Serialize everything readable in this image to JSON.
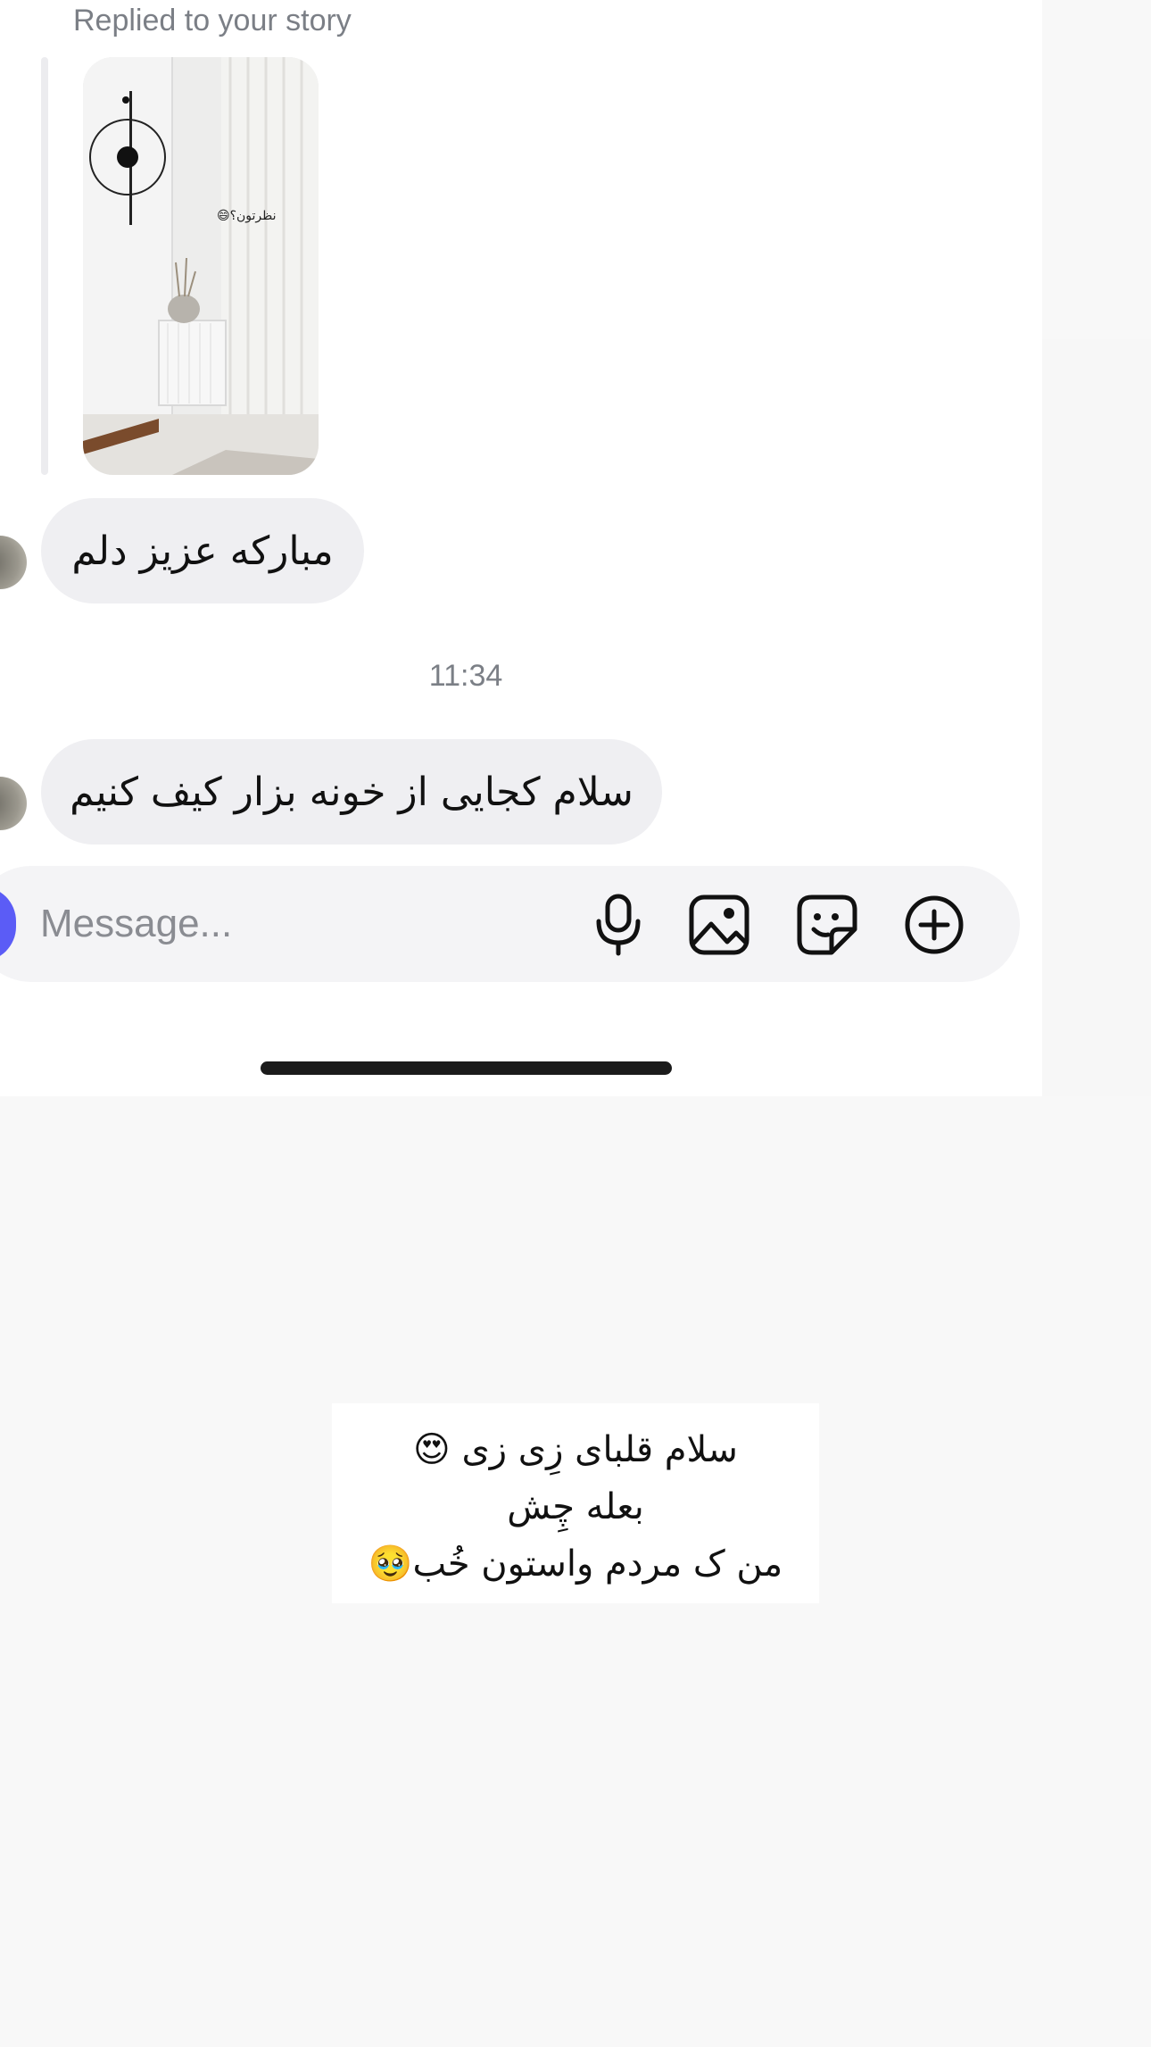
{
  "story_reply": {
    "caption": "Replied to your story",
    "overlay_text": "نظرتون؟😄"
  },
  "messages": [
    {
      "text": "مبارکه عزیز دلم"
    },
    {
      "text": "سلام کجایی از خونه بزار کیف کنیم"
    }
  ],
  "timestamp": "11:34",
  "composer": {
    "placeholder": "Message...",
    "icons": [
      "camera-icon",
      "microphone-icon",
      "gallery-icon",
      "sticker-icon",
      "add-icon"
    ]
  },
  "quoted_text": {
    "line1": "سلام قلبای زِی زی 😍",
    "line2": "بعله چِش",
    "line3": "من ک مردم واستون خُب🥹"
  },
  "colors": {
    "bubble": "#efeff2",
    "camera_button": "#5b5cf6",
    "muted_text": "#7b7f86"
  }
}
